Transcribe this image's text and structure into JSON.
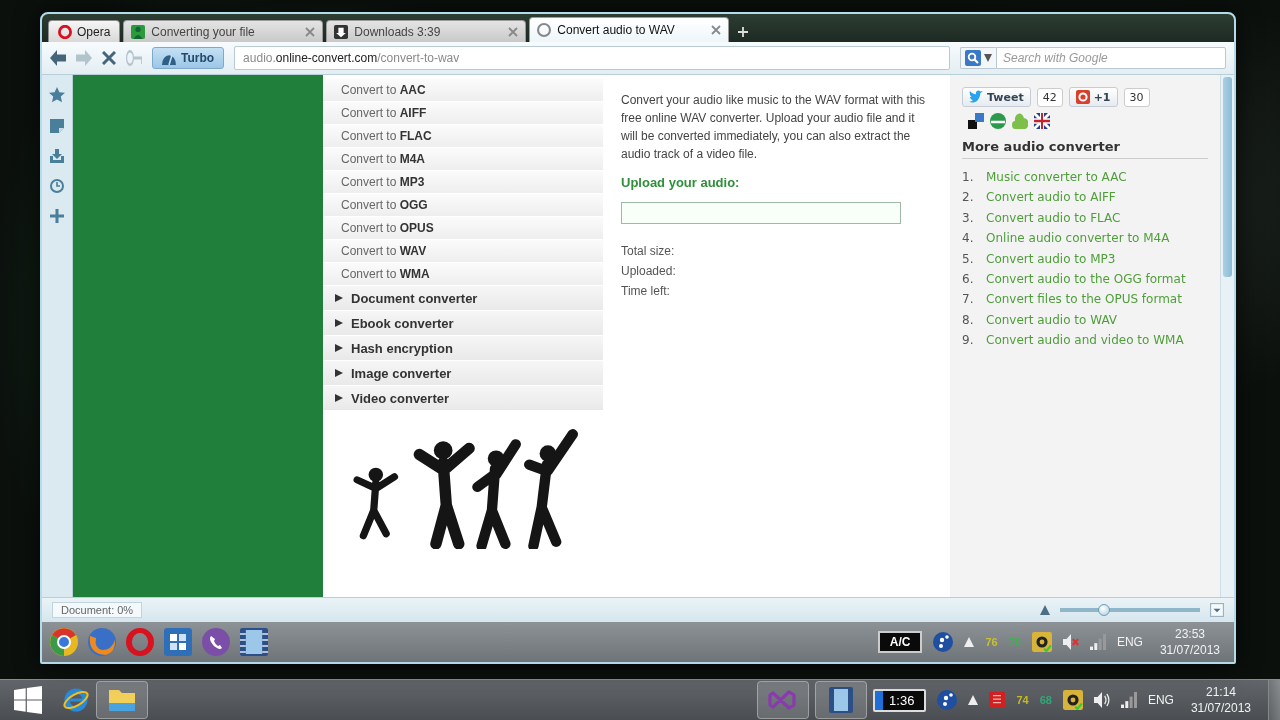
{
  "browser": {
    "menu_button": "Opera",
    "tabs": [
      {
        "kind": "site",
        "label": "Converting your file",
        "selected": false
      },
      {
        "kind": "downloads",
        "label": "Downloads 3:39",
        "selected": false
      },
      {
        "kind": "loading",
        "label": "Convert audio to WAV",
        "selected": true
      }
    ],
    "turbo": "Turbo",
    "url": "audio.**online-convert.com**/convert-to-wav",
    "search": {
      "placeholder": "Search with Google"
    }
  },
  "page": {
    "menu": [
      {
        "kind": "format",
        "label": "Convert to **AAC**"
      },
      {
        "kind": "format",
        "label": "Convert to **AIFF**"
      },
      {
        "kind": "format",
        "label": "Convert to **FLAC**"
      },
      {
        "kind": "format",
        "label": "Convert to **M4A**"
      },
      {
        "kind": "format",
        "label": "Convert to **MP3**"
      },
      {
        "kind": "format",
        "label": "Convert to **OGG**"
      },
      {
        "kind": "format",
        "label": "Convert to **OPUS**"
      },
      {
        "kind": "format",
        "label": "Convert to **WAV**"
      },
      {
        "kind": "format",
        "label": "Convert to **WMA**"
      },
      {
        "kind": "category",
        "label": "Document converter"
      },
      {
        "kind": "category",
        "label": "Ebook converter"
      },
      {
        "kind": "category",
        "label": "Hash encryption"
      },
      {
        "kind": "category",
        "label": "Image converter"
      },
      {
        "kind": "category",
        "label": "Video converter"
      }
    ],
    "intro": "Convert your audio like music to the WAV format with this free online WAV converter. Upload your audio file and it will be converted immediately, you can also extract the audio track of a video file.",
    "upload_label": "Upload your audio:",
    "upload_info": [
      "Total size:",
      "Uploaded:",
      "Time left:"
    ],
    "social": [
      {
        "kind": "tweet",
        "label": "Tweet",
        "count": "42"
      },
      {
        "kind": "plusone",
        "label": "+1",
        "count": "30"
      }
    ],
    "more": {
      "heading": "More audio converter",
      "links": [
        {
          "number": "1.",
          "label": "Music converter to AAC"
        },
        {
          "number": "2.",
          "label": "Convert audio to AIFF"
        },
        {
          "number": "3.",
          "label": "Convert audio to FLAC"
        },
        {
          "number": "4.",
          "label": "Online audio converter to M4A"
        },
        {
          "number": "5.",
          "label": "Convert audio to MP3"
        },
        {
          "number": "6.",
          "label": "Convert audio to the OGG format"
        },
        {
          "number": "7.",
          "label": "Convert files to the OPUS format"
        },
        {
          "number": "8.",
          "label": "Convert audio to WAV"
        },
        {
          "number": "9.",
          "label": "Convert audio and video to WMA"
        }
      ]
    }
  },
  "status_bar": {
    "text": "Document: 0%",
    "zoom": {
      "level": 0.3
    }
  },
  "old_taskbar": {
    "battery": "A/C",
    "readings": [
      {
        "text": "76",
        "color": "#c8c02c"
      },
      {
        "text": "70",
        "color": "#3cb44c"
      }
    ],
    "language": "ENG",
    "time": "23:53",
    "date": "31/07/2013"
  },
  "taskbar": {
    "battery": "1:36",
    "readings": [
      {
        "text": "74",
        "color": "#c8b820"
      },
      {
        "text": "68",
        "color": "#2ea878"
      }
    ],
    "language": "ENG",
    "time": "21:14",
    "date": "31/07/2013"
  }
}
